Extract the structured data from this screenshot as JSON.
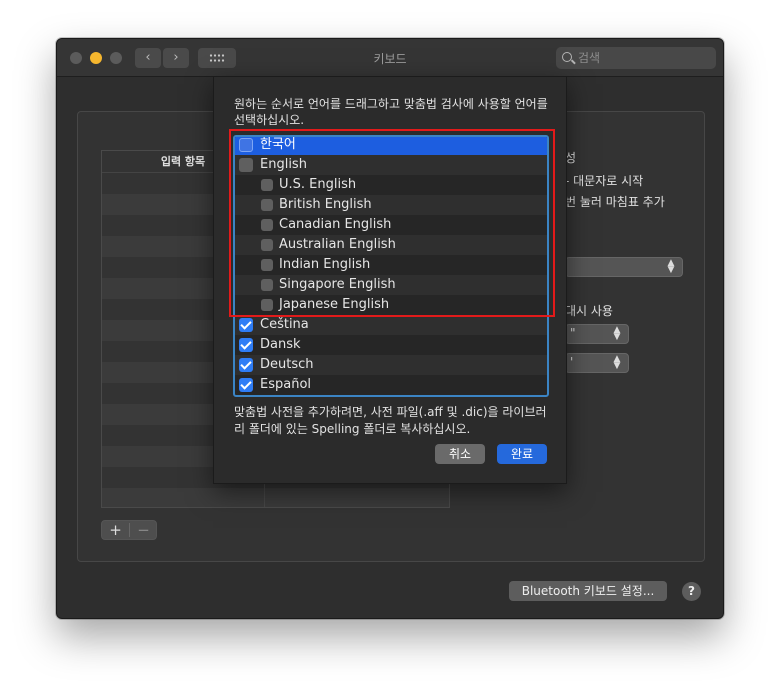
{
  "window": {
    "title": "키보드",
    "search_placeholder": "검색"
  },
  "input_list": {
    "header": "입력 항목",
    "add_label": "+",
    "remove_label": "−"
  },
  "right_panel": {
    "text1": "성",
    "text2": "- 대문자로 시작",
    "text3": "번 눌러 마침표 추가",
    "text4": "대시 사용",
    "quote1": "\"",
    "quote2": "'"
  },
  "footer": {
    "bluetooth_button": "Bluetooth 키보드 설정...",
    "help_label": "?"
  },
  "sheet": {
    "prompt": "원하는 순서로 언어를 드래그하고 맞춤법 검사에 사용할 언어를 선택하십시오.",
    "languages": [
      {
        "label": "한국어",
        "checked": false,
        "indent": 0,
        "selected": true
      },
      {
        "label": "English",
        "checked": false,
        "indent": 0,
        "selected": false
      },
      {
        "label": "U.S. English",
        "checked": false,
        "indent": 1,
        "selected": false
      },
      {
        "label": "British English",
        "checked": false,
        "indent": 1,
        "selected": false
      },
      {
        "label": "Canadian English",
        "checked": false,
        "indent": 1,
        "selected": false
      },
      {
        "label": "Australian English",
        "checked": false,
        "indent": 1,
        "selected": false
      },
      {
        "label": "Indian English",
        "checked": false,
        "indent": 1,
        "selected": false
      },
      {
        "label": "Singapore English",
        "checked": false,
        "indent": 1,
        "selected": false
      },
      {
        "label": "Japanese English",
        "checked": false,
        "indent": 1,
        "selected": false
      },
      {
        "label": "Čeština",
        "checked": true,
        "indent": 0,
        "selected": false
      },
      {
        "label": "Dansk",
        "checked": true,
        "indent": 0,
        "selected": false
      },
      {
        "label": "Deutsch",
        "checked": true,
        "indent": 0,
        "selected": false
      },
      {
        "label": "Español",
        "checked": true,
        "indent": 0,
        "selected": false
      }
    ],
    "note": "맞춤법 사전을 추가하려면, 사전 파일(.aff 및 .dic)을 라이브러리 폴더에 있는 Spelling 폴더로 복사하십시오.",
    "cancel_label": "취소",
    "done_label": "완료"
  },
  "colors": {
    "accent": "#2569dc",
    "selection": "#1d5ee0",
    "highlight_box": "#e21a1a"
  }
}
